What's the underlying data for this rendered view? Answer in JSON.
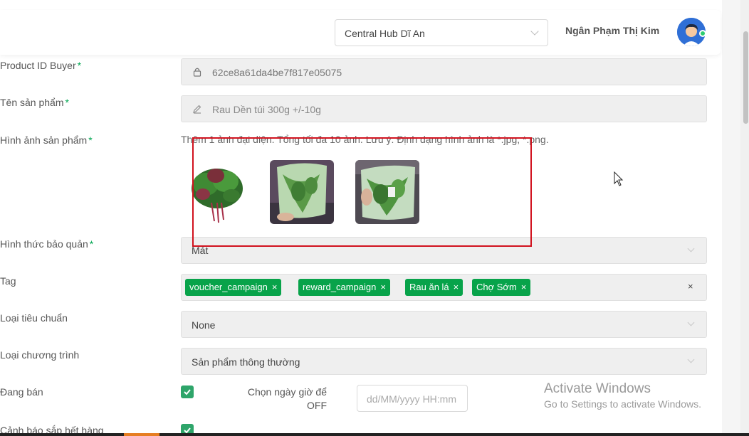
{
  "header": {
    "hub_select": "Central Hub Dĩ An",
    "user_name": "Ngân Phạm Thị Kim"
  },
  "form": {
    "product_id": {
      "label": "Product ID Buyer",
      "required": "*",
      "value": "62ce8a61da4be7f817e05075"
    },
    "product_name": {
      "label": "Tên sản phẩm",
      "required": "*",
      "value": "Rau Dền túi 300g +/-10g"
    },
    "images": {
      "label": "Hình ảnh sản phẩm",
      "required": "*",
      "hint": "Thêm 1 ảnh đại diện. Tổng tối đa 10 ảnh. Lưu ý: Định dạng hình ảnh là *.jpg, *.png."
    },
    "storage": {
      "label": "Hình thức bảo quản",
      "required": "*",
      "value": "Mát"
    },
    "tag": {
      "label": "Tag",
      "items": [
        "voucher_campaign",
        "reward_campaign",
        "Rau ăn lá",
        "Chợ Sớm"
      ],
      "remove": "×",
      "clear": "×"
    },
    "standard": {
      "label": "Loại tiêu chuẩn",
      "value": "None"
    },
    "program": {
      "label": "Loại chương trình",
      "value": "Sản phẩm thông thường"
    },
    "on_sale": {
      "label": "Đang bán",
      "schedule_label": "Chọn ngày giờ để OFF",
      "date_placeholder": "dd/MM/yyyy HH:mm"
    },
    "low_stock": {
      "label": "Cảnh báo sắp hết hàng"
    }
  },
  "watermark": {
    "line1": "Activate Windows",
    "line2": "Go to Settings to activate Windows."
  },
  "colors": {
    "accent_green": "#08a34a",
    "highlight_red": "#d1121e",
    "checkbox_green": "#2ea56a"
  }
}
